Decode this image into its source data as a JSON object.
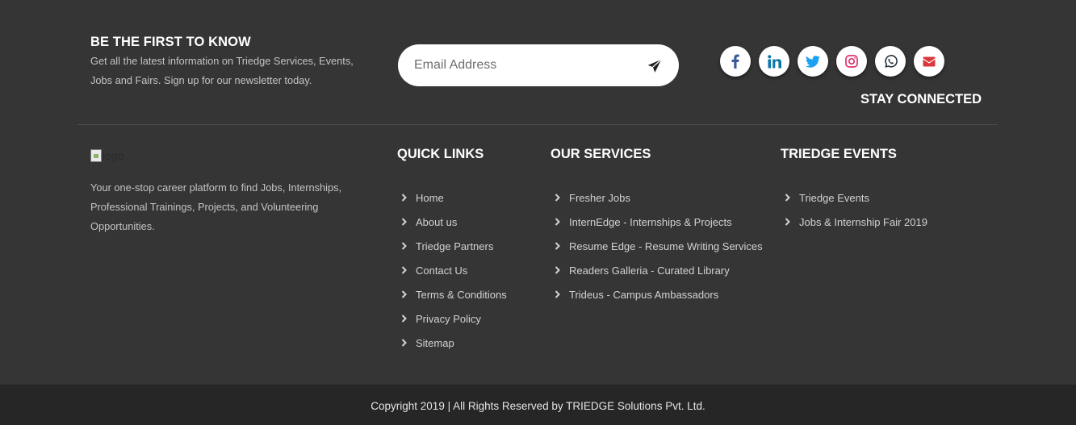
{
  "newsletter": {
    "title": "BE THE FIRST TO KNOW",
    "description": "Get all the latest information on Triedge Services, Events, Jobs and Fairs. Sign up for our newsletter today.",
    "email_placeholder": "Email Address",
    "send_icon": "paper-plane-icon"
  },
  "social": {
    "heading": "STAY CONNECTED",
    "icons": [
      {
        "name": "facebook-icon",
        "color": "#3b5998"
      },
      {
        "name": "linkedin-icon",
        "color": "#0e76a8"
      },
      {
        "name": "twitter-icon",
        "color": "#1da1f2"
      },
      {
        "name": "instagram-icon",
        "color": "#e1306c"
      },
      {
        "name": "whatsapp-icon",
        "color": "#25343f"
      },
      {
        "name": "mail-icon",
        "color": "#d9393c"
      }
    ]
  },
  "brand": {
    "logo_alt": "logo",
    "about": "Your one-stop career platform to find Jobs, Internships, Professional Trainings, Projects, and Volunteering Opportunities."
  },
  "quick_links": {
    "title": "QUICK LINKS",
    "items": [
      "Home",
      "About us",
      "Triedge Partners",
      "Contact Us",
      "Terms & Conditions",
      "Privacy Policy",
      "Sitemap"
    ]
  },
  "services": {
    "title": "OUR SERVICES",
    "items": [
      "Fresher Jobs",
      "InternEdge - Internships & Projects",
      "Resume Edge - Resume Writing Services",
      "Readers Galleria - Curated Library",
      "Trideus - Campus Ambassadors"
    ]
  },
  "events": {
    "title": "TRIEDGE EVENTS",
    "items": [
      "Triedge Events",
      "Jobs & Internship Fair 2019"
    ]
  },
  "footer": {
    "copyright": "Copyright 2019 | All Rights Reserved by TRIEDGE Solutions Pvt. Ltd."
  }
}
